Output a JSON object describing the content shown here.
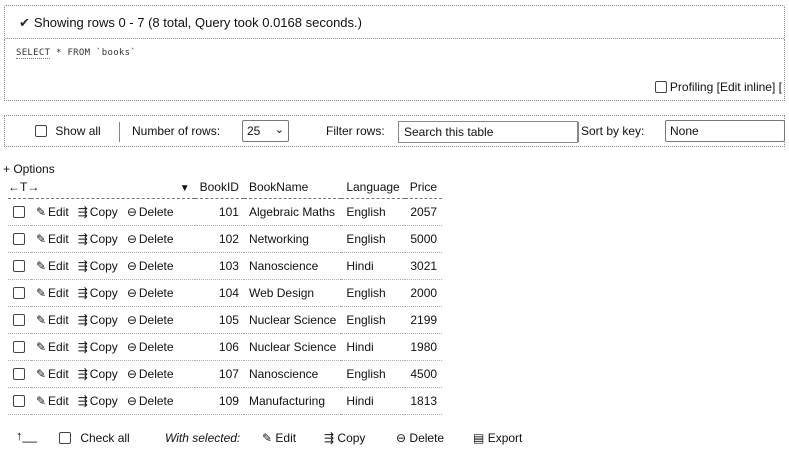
{
  "message": {
    "success_text": "Showing rows 0 - 7 (8 total, Query took 0.0168 seconds.)"
  },
  "sql": {
    "select_kw": "SELECT",
    "rest": "* FROM `books`"
  },
  "sql_links": {
    "profiling": "Profiling",
    "edit_inline": "[Edit inline]",
    "trailing": "["
  },
  "navigation": {
    "show_all": "Show all",
    "number_of_rows_label": "Number of rows:",
    "rows_value": "25",
    "filter_label": "Filter rows:",
    "filter_placeholder": "Search this table",
    "sort_label": "Sort by key:",
    "sort_value": "None"
  },
  "options_link": "+ Options",
  "table": {
    "arrows": "←T→",
    "columns": [
      "BookID",
      "BookName",
      "Language",
      "Price"
    ],
    "action_labels": {
      "edit": "Edit",
      "copy": "Copy",
      "delete": "Delete"
    },
    "rows": [
      {
        "id": "101",
        "name": "Algebraic Maths",
        "language": "English",
        "price": "2057"
      },
      {
        "id": "102",
        "name": "Networking",
        "language": "English",
        "price": "5000"
      },
      {
        "id": "103",
        "name": "Nanoscience",
        "language": "Hindi",
        "price": "3021"
      },
      {
        "id": "104",
        "name": "Web Design",
        "language": "English",
        "price": "2000"
      },
      {
        "id": "105",
        "name": "Nuclear Science",
        "language": "English",
        "price": "2199"
      },
      {
        "id": "106",
        "name": "Nuclear Science",
        "language": "Hindi",
        "price": "1980"
      },
      {
        "id": "107",
        "name": "Nanoscience",
        "language": "English",
        "price": "4500"
      },
      {
        "id": "109",
        "name": "Manufacturing",
        "language": "Hindi",
        "price": "1813"
      }
    ]
  },
  "footer": {
    "check_all": "Check all",
    "with_selected": "With selected:",
    "edit": "Edit",
    "copy": "Copy",
    "delete": "Delete",
    "export": "Export"
  }
}
